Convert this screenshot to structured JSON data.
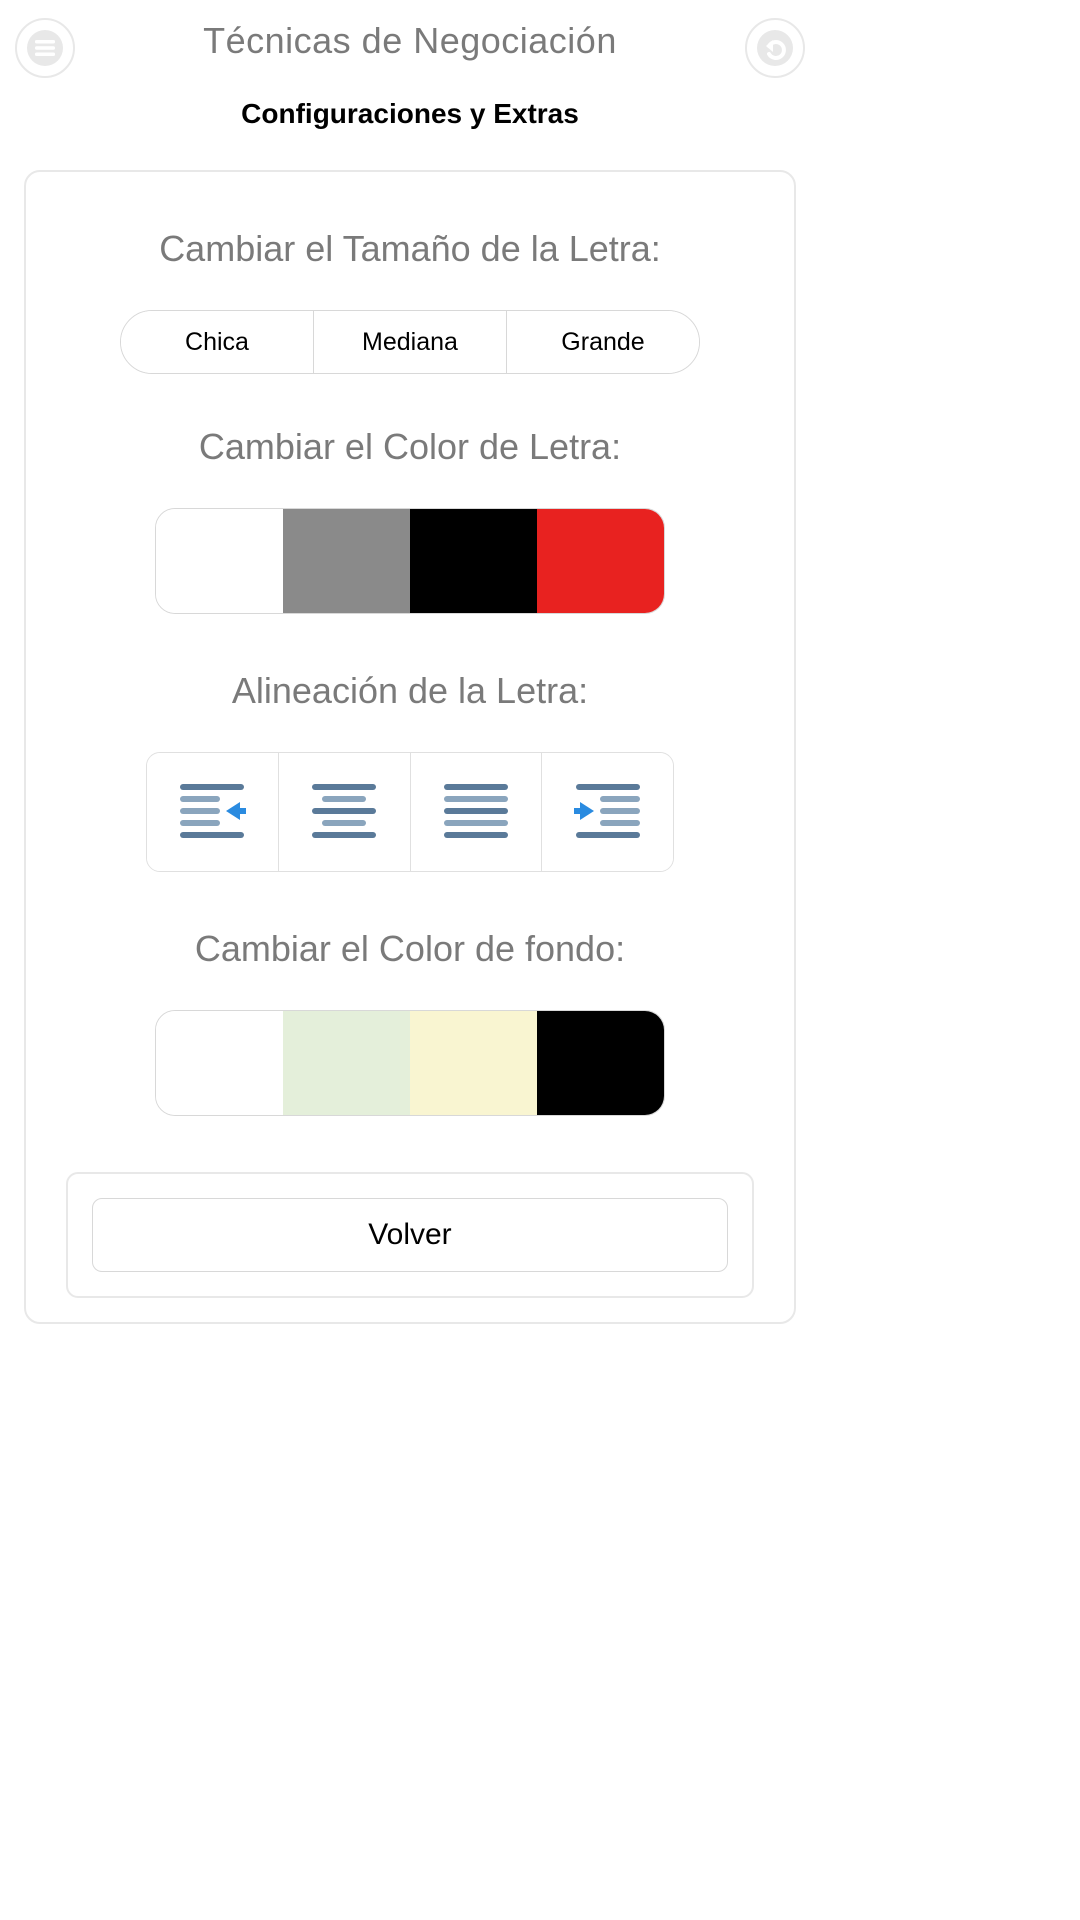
{
  "header": {
    "title": "Técnicas de Negociación",
    "subtitle": "Configuraciones y Extras"
  },
  "sections": {
    "fontSize": {
      "title": "Cambiar el Tamaño de la Letra:",
      "options": [
        "Chica",
        "Mediana",
        "Grande"
      ]
    },
    "fontColor": {
      "title": "Cambiar el Color de Letra:",
      "colors": [
        "#ffffff",
        "#8a8a8a",
        "#000000",
        "#e82220"
      ]
    },
    "alignment": {
      "title": "Alineación de la Letra:",
      "options": [
        "outdent",
        "center",
        "justify",
        "indent"
      ]
    },
    "bgColor": {
      "title": "Cambiar el Color de fondo:",
      "colors": [
        "#ffffff",
        "#e4efda",
        "#f9f5d1",
        "#000000"
      ]
    }
  },
  "footer": {
    "back_label": "Volver"
  },
  "iconColors": {
    "hamburger": "#d8d8d8",
    "back": "#d8d8d8",
    "alignLine": "#5a7a99",
    "alignArrow": "#2a8be0"
  }
}
